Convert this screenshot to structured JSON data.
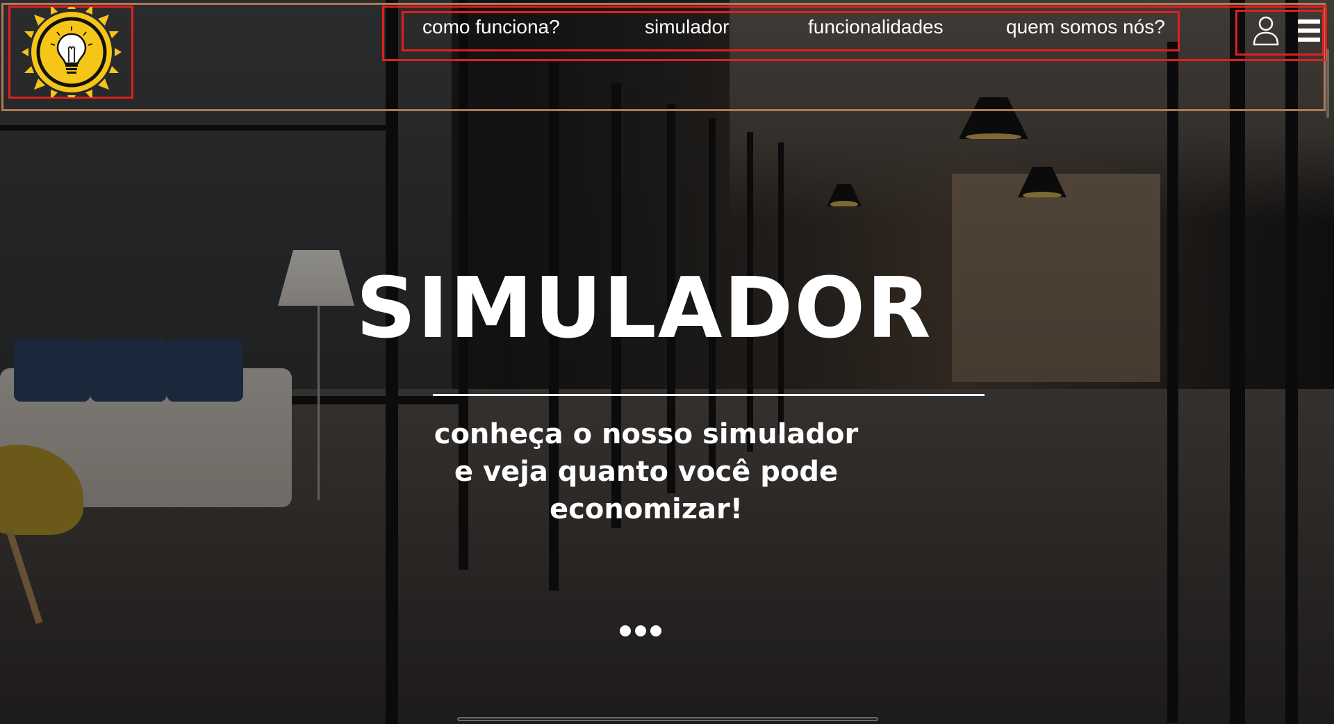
{
  "header": {
    "logo_icon": "lightbulb-sun-icon",
    "nav": [
      {
        "label": "como funciona?"
      },
      {
        "label": "simulador"
      },
      {
        "label": "funcionalidades"
      },
      {
        "label": "quem somos nós?"
      }
    ],
    "user_icon": "user-icon",
    "menu_icon": "hamburger-menu-icon"
  },
  "hero": {
    "title": "SIMULADOR",
    "subtitle_lines": [
      "conheça o nosso simulador",
      "e veja quanto você pode",
      "economizar!"
    ],
    "carousel_dots": 3
  },
  "colors": {
    "accent_yellow": "#f5c518",
    "outline_red": "#e01f1f",
    "header_border": "#b07a55",
    "text": "#ffffff"
  }
}
